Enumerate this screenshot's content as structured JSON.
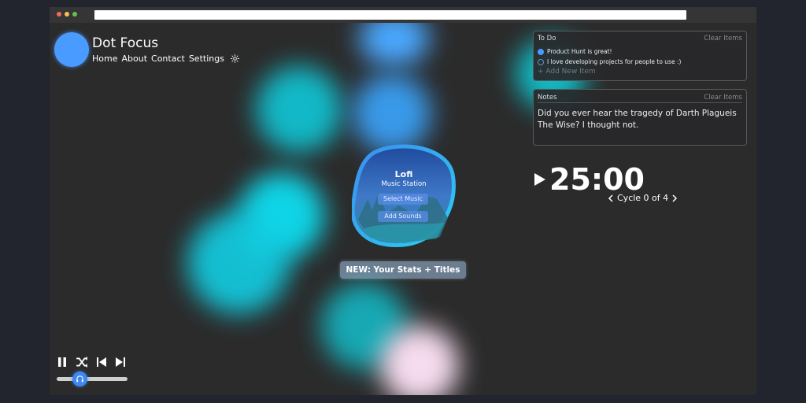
{
  "site": {
    "title": "Dot Focus",
    "nav": [
      "Home",
      "About",
      "Contact",
      "Settings"
    ],
    "accent": "#4a9bff"
  },
  "todo": {
    "title": "To Do",
    "clear_label": "Clear Items",
    "items": [
      {
        "text": "Product Hunt is great!",
        "done": true
      },
      {
        "text": "I love developing projects for people to use :)",
        "done": false
      }
    ],
    "add_label": "+ Add New Item"
  },
  "notes": {
    "title": "Notes",
    "clear_label": "Clear Items",
    "text": "Did you ever hear the tragedy of Darth Plagueis The Wise? I thought not."
  },
  "timer": {
    "value": "25:00",
    "cycle_label": "Cycle 0 of 4"
  },
  "music": {
    "title": "Lofi",
    "subtitle": "Music Station",
    "select_label": "Select Music",
    "sounds_label": "Add Sounds"
  },
  "stats_button": "NEW: Your Stats + Titles",
  "player": {
    "icons": [
      "pause-icon",
      "shuffle-icon",
      "previous-icon",
      "next-icon"
    ],
    "volume_fraction": 0.33
  }
}
